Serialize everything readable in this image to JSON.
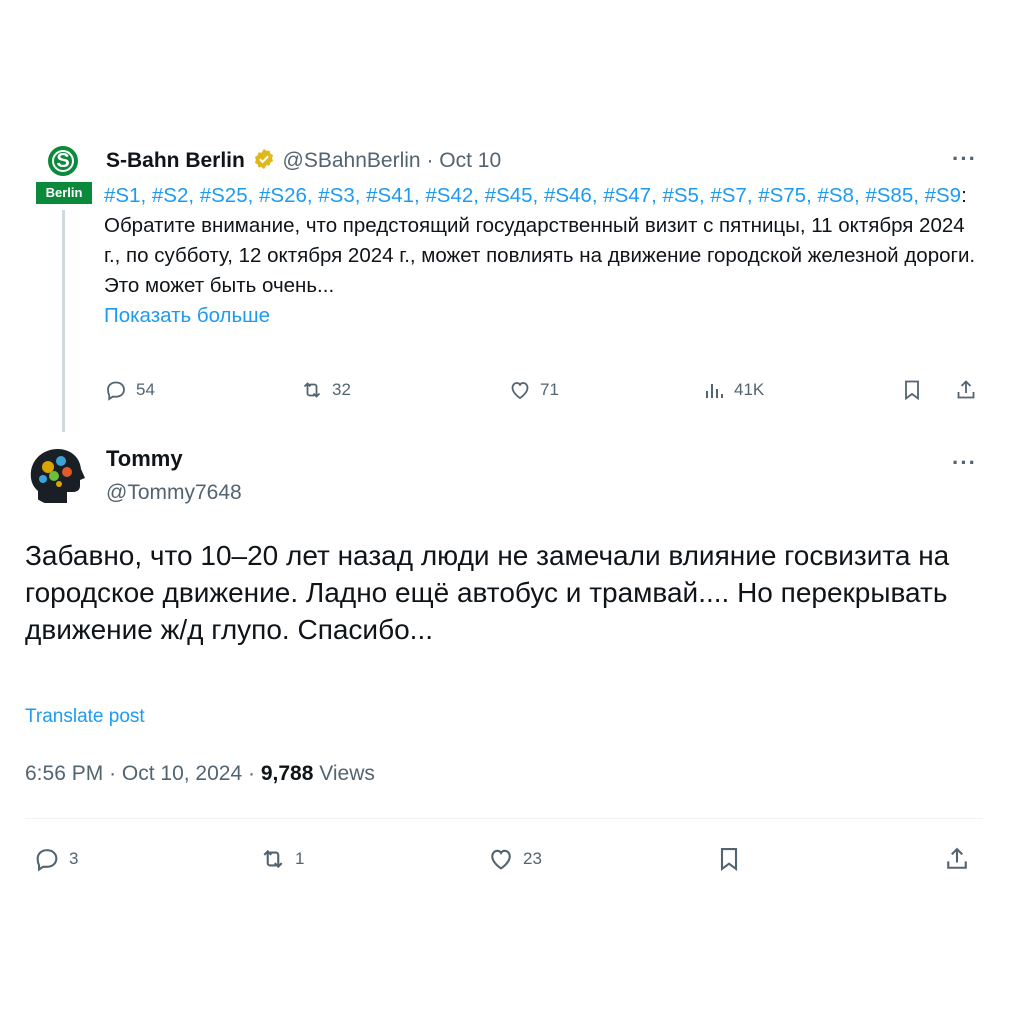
{
  "quoted": {
    "logo_text": "Berlin",
    "logo_letter": "S",
    "name": "S-Bahn Berlin",
    "handle": "@SBahnBerlin",
    "sep": "·",
    "date": "Oct 10",
    "hashtags_line": "#S1, #S2, #S25, #S26, #S3, #S41, #S42, #S45, #S46, #S47, #S5, #S7, #S75, #S8, #S85, #S9",
    "body": ": Обратите внимание, что предстоящий государственный визит с пятницы, 11 октября 2024 г., по субботу, 12 октября 2024 г., может повлиять на движение городской железной дороги. Это может быть очень...",
    "show_more": "Показать больше",
    "stats": {
      "replies": "54",
      "reposts": "32",
      "likes": "71",
      "views": "41K"
    },
    "more": "···"
  },
  "reply": {
    "name": "Tommy",
    "handle": "@Tommy7648",
    "more": "···",
    "text": "Забавно, что 10–20 лет назад люди не замечали влияние госвизита на городское движение. Ладно ещё автобус и трамвай.... Но перекрывать движение ж/д глупо. Спасибо...",
    "translate": "Translate post",
    "time": "6:56 PM",
    "date": "Oct 10, 2024",
    "sep": "·",
    "views_count": "9,788",
    "views_label": "Views",
    "stats": {
      "replies": "3",
      "reposts": "1",
      "likes": "23"
    }
  },
  "colors": {
    "accent": "#1d9bf0",
    "sbahn_green": "#0a8a3a",
    "muted": "#536471",
    "verified_gold": "#e2b719"
  }
}
